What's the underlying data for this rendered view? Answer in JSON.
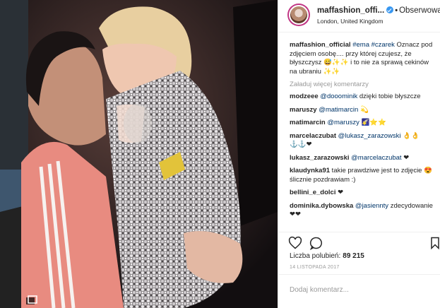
{
  "post": {
    "username": "maffashion_offi...",
    "follow_label": "Obserwowani",
    "location": "London, United Kingdom",
    "caption": {
      "user": "maffashion_official",
      "hashtags": "#ema #czarek",
      "text": " Oznacz pod zdjęciem osobę.... przy której czujesz, że błyszczysz 😅✨✨ i to nie za sprawą cekinów na ubraniu ✨✨"
    },
    "load_more": "Załaduj więcej komentarzy",
    "likes_label": "Liczba polubień:",
    "likes_count": "89 215",
    "date": "14 LISTOPADA 2017",
    "add_comment_placeholder": "Dodaj komentarz..."
  },
  "comments": [
    {
      "user": "modzeee",
      "mention": "@dooominik",
      "text": " dzięki tobie błyszcze"
    },
    {
      "user": "maruszy",
      "mention": "@matimarcin",
      "text": " 💫"
    },
    {
      "user": "matimarcin",
      "mention": "@maruszy",
      "text": " 🌠⭐⭐"
    },
    {
      "user": "marcelaczubat",
      "mention": "@lukasz_zarazowski",
      "text": " 👌👌 ⚓⚓❤"
    },
    {
      "user": "lukasz_zarazowski",
      "mention": "@marcelaczubat",
      "text": " ❤"
    },
    {
      "user": "klaudynka91",
      "mention": "",
      "text": " takie prawdziwe jest to zdjęcie 😍 ślicznie pozdrawiam :)"
    },
    {
      "user": "bellini_e_dolci",
      "mention": "",
      "text": " ❤"
    },
    {
      "user": "dominika.dybowska",
      "mention": "@jasiennty",
      "text": " zdecydowanie❤❤"
    }
  ],
  "colors": {
    "mention": "#003569",
    "verified": "#3897f0",
    "muted": "#999999",
    "text": "#262626"
  },
  "icons": [
    "verified-badge-icon",
    "heart-icon",
    "comment-icon",
    "bookmark-icon",
    "multiple-photos-icon"
  ]
}
